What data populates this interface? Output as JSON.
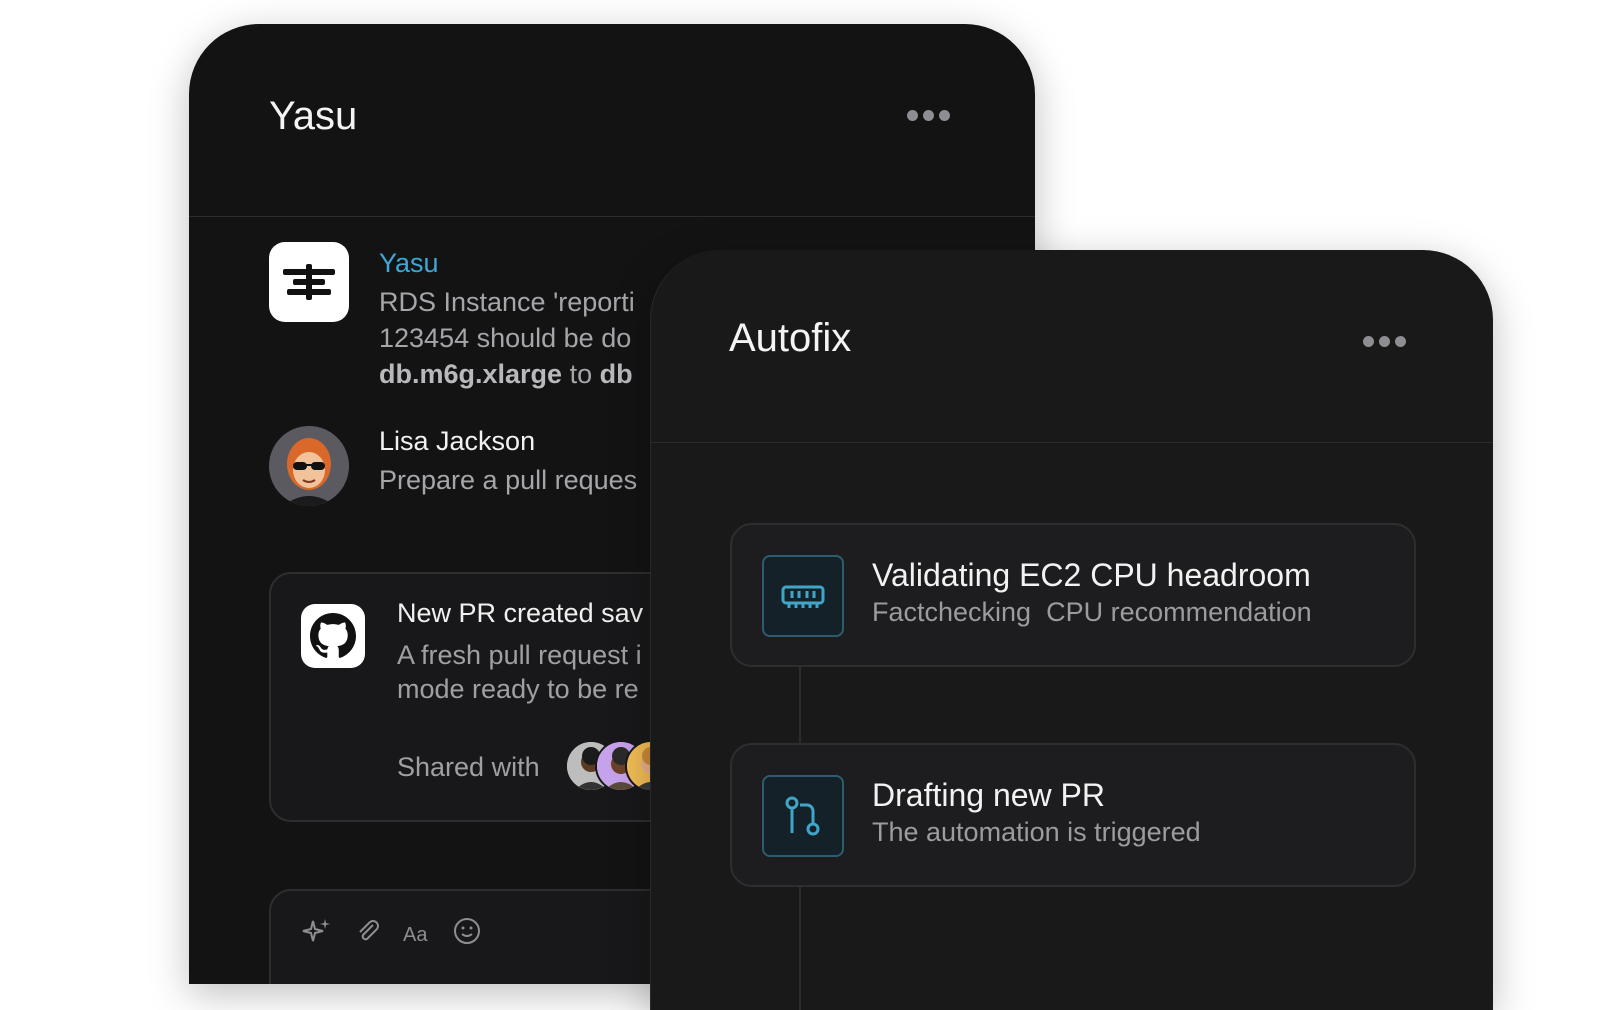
{
  "yasu_panel": {
    "title": "Yasu",
    "messages": [
      {
        "author": "Yasu",
        "lines": [
          "RDS Instance 'reporti",
          "123454 should be do"
        ],
        "line3_bold_a": "db.m6g.xlarge",
        "line3_mid": " to ",
        "line3_bold_b": "db"
      },
      {
        "author": "Lisa Jackson",
        "text": "Prepare a pull reques"
      }
    ],
    "pr_card": {
      "title": "New PR created sav",
      "desc_lines": [
        "A fresh pull request i",
        "mode ready to be re"
      ],
      "shared_label": "Shared with"
    },
    "composer": {
      "icons": [
        "sparkle-icon",
        "attachment-icon",
        "text-format-icon",
        "emoji-icon"
      ]
    }
  },
  "autofix_panel": {
    "title": "Autofix",
    "tasks": [
      {
        "title": "Validating EC2 CPU headroom",
        "subtitle": "Factchecking  CPU recommendation",
        "icon": "memory-chip-icon"
      },
      {
        "title": "Drafting new PR",
        "subtitle": "The automation is triggered",
        "icon": "git-pull-request-icon"
      }
    ]
  },
  "colors": {
    "panel_bg": "#131314",
    "accent_blue": "#3ea7d6",
    "icon_teal": "#3fa6c9"
  }
}
